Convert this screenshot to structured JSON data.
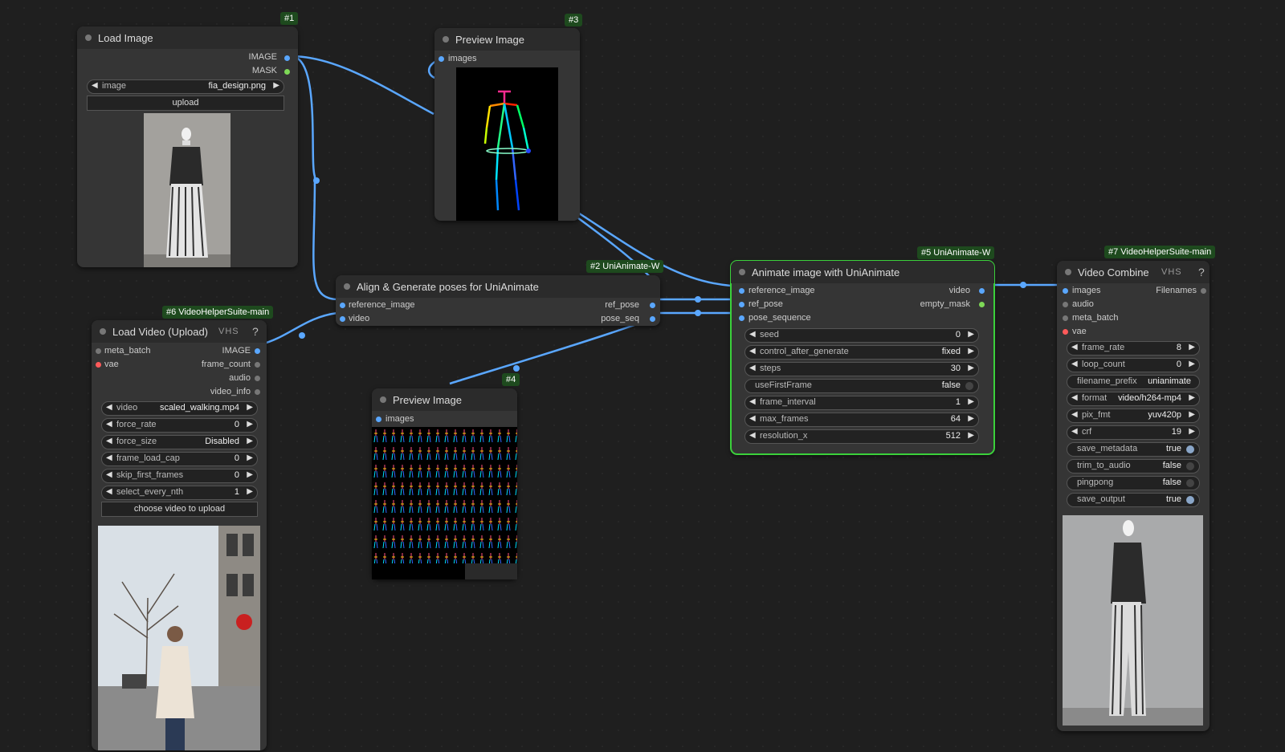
{
  "nodes": {
    "load_image": {
      "badge": "#1",
      "title": "Load Image",
      "out_image": "IMAGE",
      "out_mask": "MASK",
      "w_image_label": "image",
      "w_image_value": "fia_design.png",
      "upload_label": "upload"
    },
    "preview3": {
      "badge": "#3",
      "title": "Preview Image",
      "in_images": "images"
    },
    "align": {
      "badge": "#2 UniAnimate-W",
      "title": "Align & Generate poses for UniAnimate",
      "in_ref": "reference_image",
      "in_video": "video",
      "out_ref_pose": "ref_pose",
      "out_pose_seq": "pose_seq"
    },
    "load_video": {
      "badge": "#6 VideoHelperSuite-main",
      "title": "Load Video (Upload)",
      "vhs": "VHS",
      "in_meta": "meta_batch",
      "in_vae": "vae",
      "out_image": "IMAGE",
      "out_frame_count": "frame_count",
      "out_audio": "audio",
      "out_video_info": "video_info",
      "widgets": [
        {
          "label": "video",
          "value": "scaled_walking.mp4"
        },
        {
          "label": "force_rate",
          "value": "0"
        },
        {
          "label": "force_size",
          "value": "Disabled"
        },
        {
          "label": "frame_load_cap",
          "value": "0"
        },
        {
          "label": "skip_first_frames",
          "value": "0"
        },
        {
          "label": "select_every_nth",
          "value": "1"
        }
      ],
      "button": "choose video to upload"
    },
    "preview4": {
      "badge": "#4",
      "title": "Preview Image",
      "in_images": "images"
    },
    "animate": {
      "badge": "#5 UniAnimate-W",
      "title": "Animate image with UniAnimate",
      "in_ref": "reference_image",
      "in_ref_pose": "ref_pose",
      "in_pose_seq": "pose_sequence",
      "out_video": "video",
      "out_empty_mask": "empty_mask",
      "widgets": [
        {
          "label": "seed",
          "value": "0"
        },
        {
          "label": "control_after_generate",
          "value": "fixed"
        },
        {
          "label": "steps",
          "value": "30"
        },
        {
          "label": "useFirstFrame",
          "value": "false"
        },
        {
          "label": "frame_interval",
          "value": "1"
        },
        {
          "label": "max_frames",
          "value": "64"
        },
        {
          "label": "resolution_x",
          "value": "512"
        }
      ]
    },
    "video_combine": {
      "badge": "#7 VideoHelperSuite-main",
      "title": "Video Combine",
      "vhs": "VHS",
      "in_images": "images",
      "in_audio": "audio",
      "in_meta": "meta_batch",
      "in_vae": "vae",
      "out_filenames": "Filenames",
      "widgets": [
        {
          "label": "frame_rate",
          "value": "8"
        },
        {
          "label": "loop_count",
          "value": "0"
        },
        {
          "label": "filename_prefix",
          "value": "unianimate"
        },
        {
          "label": "format",
          "value": "video/h264-mp4"
        },
        {
          "label": "pix_fmt",
          "value": "yuv420p"
        },
        {
          "label": "crf",
          "value": "19"
        },
        {
          "label": "save_metadata",
          "value": "true"
        },
        {
          "label": "trim_to_audio",
          "value": "false"
        },
        {
          "label": "pingpong",
          "value": "false"
        },
        {
          "label": "save_output",
          "value": "true"
        }
      ]
    }
  },
  "colors": {
    "link": "#5aa7ff",
    "selected": "#3bd13b",
    "badge_bg": "#1e4a1e"
  }
}
